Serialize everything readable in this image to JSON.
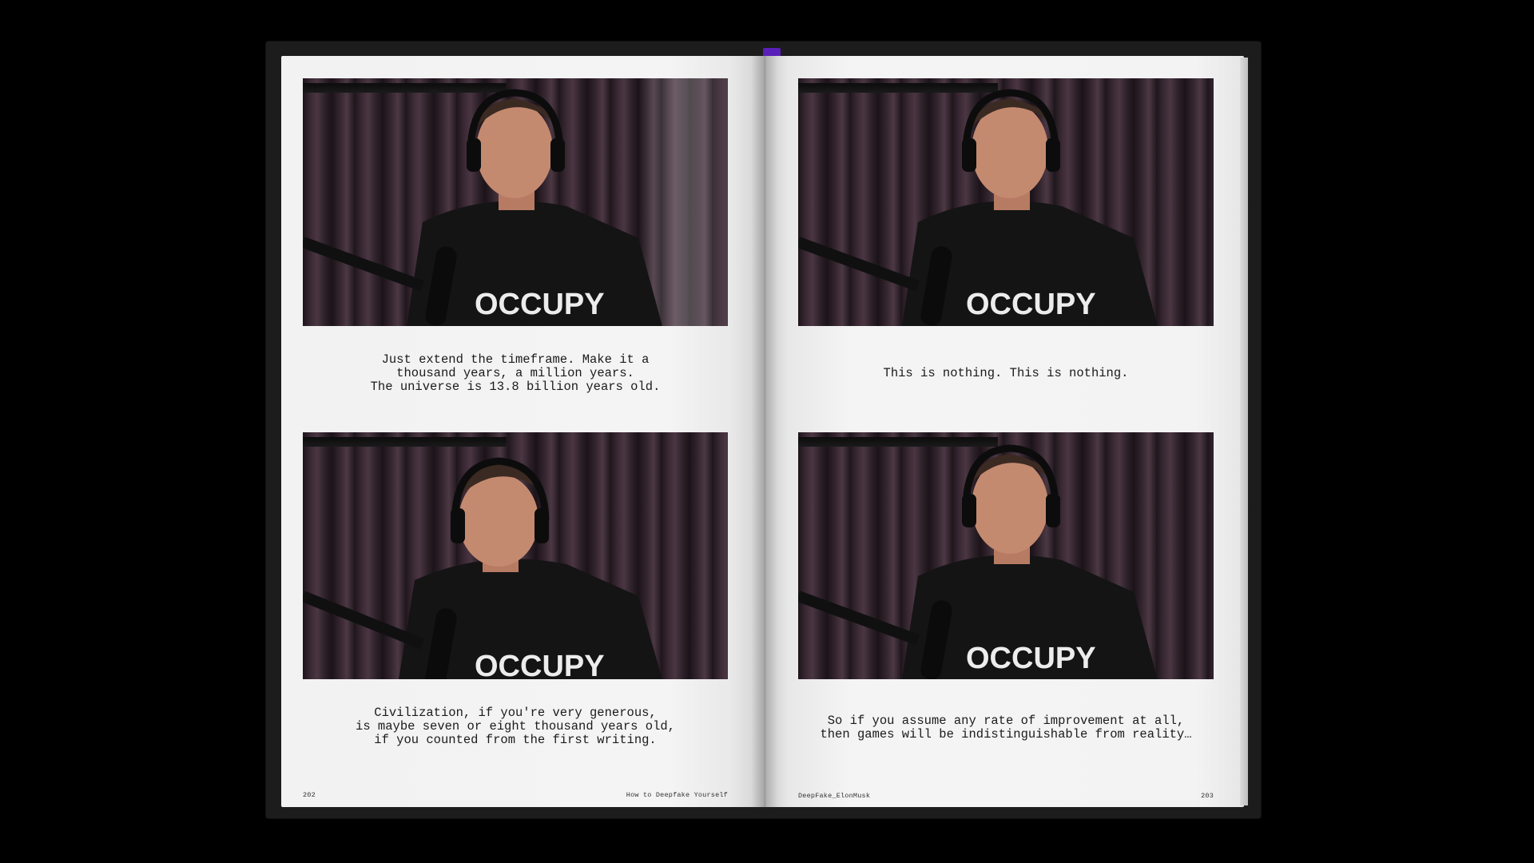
{
  "left_page": {
    "panels": [
      {
        "caption": "Just extend the timeframe. Make it a\nthousand years, a million years.\nThe universe is 13.8 billion years old.",
        "shirt_text": "OCCUPY"
      },
      {
        "caption": "Civilization, if you're very generous,\nis maybe seven or eight thousand years old,\nif you counted from the first writing.",
        "shirt_text": "OCCUPY"
      }
    ],
    "page_number": "202",
    "running_title": "How to Deepfake Yourself"
  },
  "right_page": {
    "panels": [
      {
        "caption": "This is nothing. This is nothing.",
        "shirt_text": "OCCUPY"
      },
      {
        "caption": "So if you assume any rate of improvement at all,\nthen games will be indistinguishable from reality…",
        "shirt_text": "OCCUPY"
      }
    ],
    "page_number": "203",
    "running_title": "DeepFake_ElonMusk"
  },
  "colors": {
    "background": "#000000",
    "cover": "#1c1c1c",
    "paper": "#f3f3f3",
    "ribbon": "#5a1fb8",
    "text": "#1b1b1b"
  }
}
